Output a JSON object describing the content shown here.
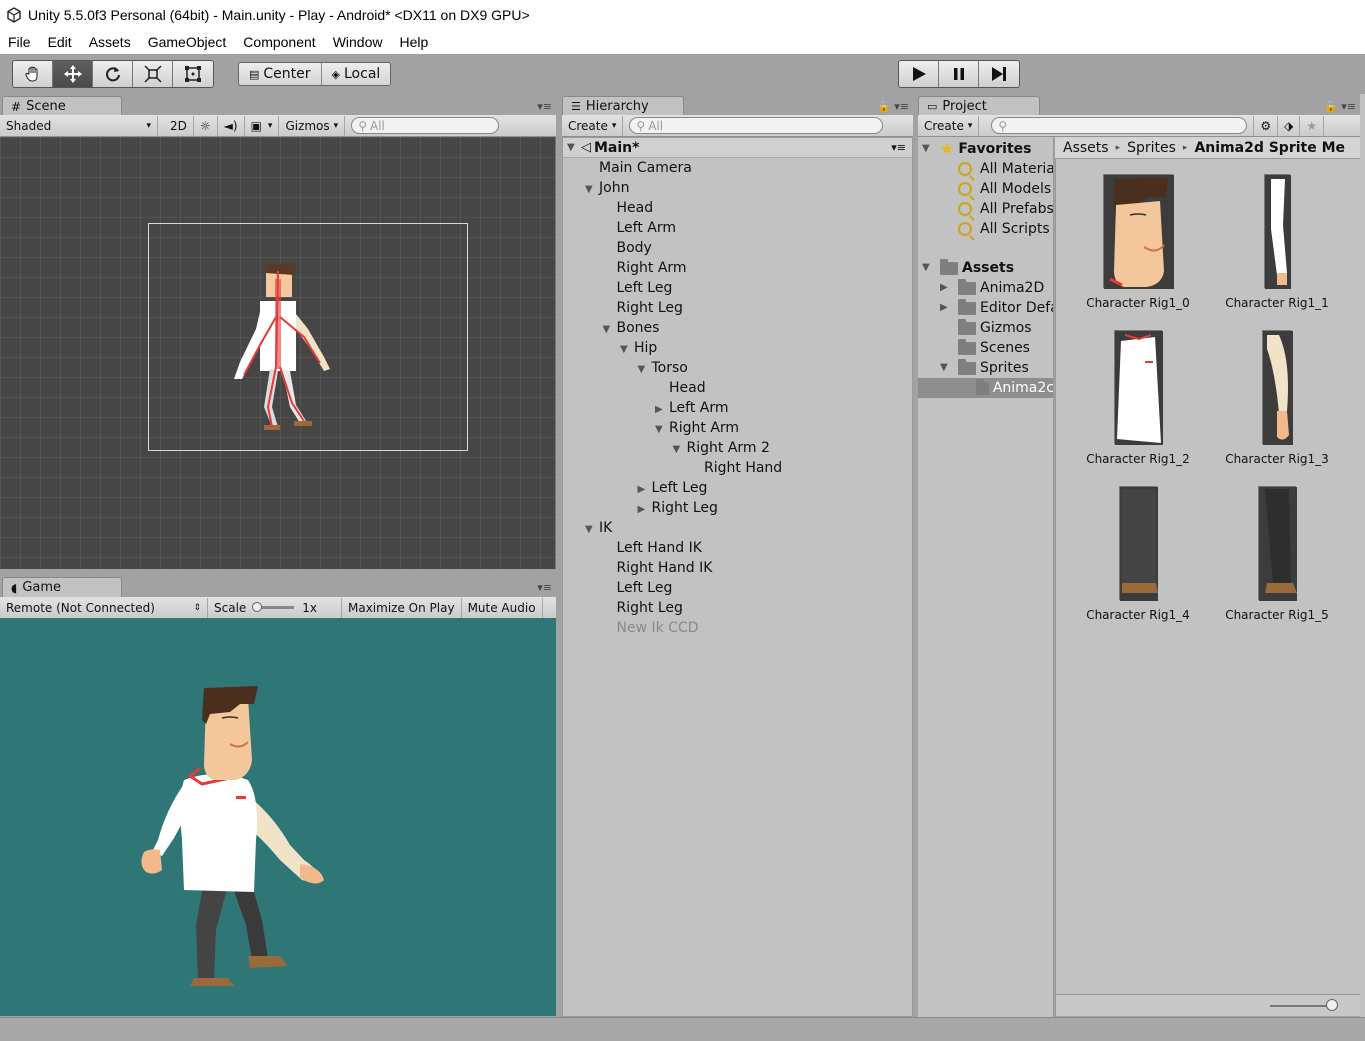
{
  "window": {
    "title": "Unity 5.5.0f3 Personal (64bit) - Main.unity - Play - Android* <DX11 on DX9 GPU>"
  },
  "menu": [
    "File",
    "Edit",
    "Assets",
    "GameObject",
    "Component",
    "Window",
    "Help"
  ],
  "toolbar": {
    "pivot_label": "Center",
    "space_label": "Local"
  },
  "scene": {
    "tab": "Scene",
    "shading": "Shaded",
    "mode_2d": "2D",
    "gizmos": "Gizmos",
    "search_placeholder": "All"
  },
  "game": {
    "tab": "Game",
    "display": "Remote (Not Connected)",
    "scale_label": "Scale",
    "scale_value": "1x",
    "maximize": "Maximize On Play",
    "mute": "Mute Audio",
    "background_color": "#2f7777"
  },
  "hierarchy": {
    "tab": "Hierarchy",
    "create": "Create",
    "search_placeholder": "All",
    "scene_name": "Main*",
    "rows": [
      {
        "label": "Main Camera",
        "level": 0,
        "arrow": ""
      },
      {
        "label": "John",
        "level": 0,
        "arrow": "down"
      },
      {
        "label": "Head",
        "level": 1,
        "arrow": ""
      },
      {
        "label": "Left Arm",
        "level": 1,
        "arrow": ""
      },
      {
        "label": "Body",
        "level": 1,
        "arrow": ""
      },
      {
        "label": "Right Arm",
        "level": 1,
        "arrow": ""
      },
      {
        "label": "Left Leg",
        "level": 1,
        "arrow": ""
      },
      {
        "label": "Right Leg",
        "level": 1,
        "arrow": ""
      },
      {
        "label": "Bones",
        "level": 1,
        "arrow": "down"
      },
      {
        "label": "Hip",
        "level": 2,
        "arrow": "down"
      },
      {
        "label": "Torso",
        "level": 3,
        "arrow": "down"
      },
      {
        "label": "Head",
        "level": 4,
        "arrow": ""
      },
      {
        "label": "Left Arm",
        "level": 4,
        "arrow": "right"
      },
      {
        "label": "Right Arm",
        "level": 4,
        "arrow": "down"
      },
      {
        "label": "Right Arm 2",
        "level": 5,
        "arrow": "down"
      },
      {
        "label": "Right Hand",
        "level": 6,
        "arrow": ""
      },
      {
        "label": "Left Leg",
        "level": 3,
        "arrow": "right"
      },
      {
        "label": "Right Leg",
        "level": 3,
        "arrow": "right"
      },
      {
        "label": "IK",
        "level": 0,
        "arrow": "down"
      },
      {
        "label": "Left Hand IK",
        "level": 1,
        "arrow": ""
      },
      {
        "label": "Right Hand IK",
        "level": 1,
        "arrow": ""
      },
      {
        "label": "Left Leg",
        "level": 1,
        "arrow": ""
      },
      {
        "label": "Right Leg",
        "level": 1,
        "arrow": ""
      },
      {
        "label": "New Ik CCD",
        "level": 1,
        "arrow": "",
        "dim": true
      }
    ]
  },
  "project": {
    "tab": "Project",
    "create": "Create",
    "favorites_label": "Favorites",
    "favorites": [
      "All Materia",
      "All Models",
      "All Prefabs",
      "All Scripts"
    ],
    "assets_label": "Assets",
    "folders": [
      {
        "label": "Anima2D",
        "arrow": "right",
        "level": 1
      },
      {
        "label": "Editor Defa",
        "arrow": "right",
        "level": 1
      },
      {
        "label": "Gizmos",
        "arrow": "",
        "level": 1
      },
      {
        "label": "Scenes",
        "arrow": "",
        "level": 1
      },
      {
        "label": "Sprites",
        "arrow": "down",
        "level": 1
      },
      {
        "label": "Anima2c",
        "arrow": "",
        "level": 2,
        "selected": true
      }
    ],
    "breadcrumb": [
      "Assets",
      "Sprites",
      "Anima2d Sprite Me"
    ],
    "sprites": [
      {
        "label": "Character Rig1_0",
        "kind": "head"
      },
      {
        "label": "Character Rig1_1",
        "kind": "arm-white"
      },
      {
        "label": "Character Rig1_2",
        "kind": "body"
      },
      {
        "label": "Character Rig1_3",
        "kind": "arm-beige"
      },
      {
        "label": "Character Rig1_4",
        "kind": "leg"
      },
      {
        "label": "Character Rig1_5",
        "kind": "leg-dark"
      }
    ]
  }
}
